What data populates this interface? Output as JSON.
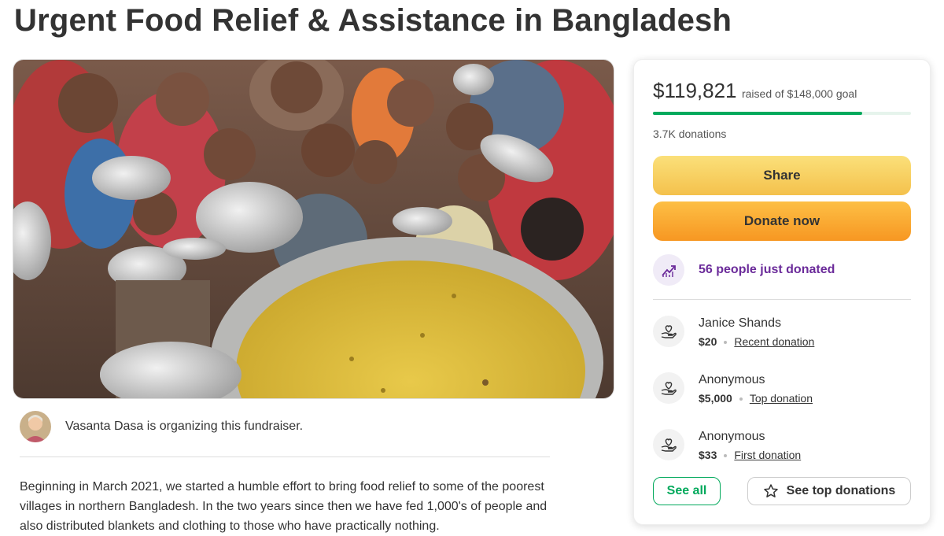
{
  "page": {
    "title": "Urgent Food Relief & Assistance in Bangladesh"
  },
  "hero": {
    "image_icon": "photo-children-with-food-bowls"
  },
  "organizer": {
    "text": "Vasanta Dasa is organizing this fundraiser."
  },
  "story": {
    "text": "Beginning in March 2021, we started a humble effort to bring food relief to some of the poorest villages in northern Bangladesh. In the two years since then we have fed 1,000's of people and also distributed blankets and clothing to those who have practically nothing."
  },
  "card": {
    "raised_amount": "$119,821",
    "goal_text": "raised of $148,000 goal",
    "progress_fraction": 0.81,
    "donations_count": "3.7K donations",
    "share_label": "Share",
    "donate_label": "Donate now",
    "just_donated": "56 people just donated",
    "donations": [
      {
        "name": "Janice Shands",
        "amount": "$20",
        "tag": "Recent donation"
      },
      {
        "name": "Anonymous",
        "amount": "$5,000",
        "tag": "Top donation"
      },
      {
        "name": "Anonymous",
        "amount": "$33",
        "tag": "First donation"
      }
    ],
    "see_all_label": "See all",
    "see_top_label": "See top donations"
  },
  "colors": {
    "accent_green": "#02a95c",
    "share_yellow": "#f4c14c",
    "donate_orange": "#f79722",
    "trending_purple": "#6b2b9a"
  }
}
